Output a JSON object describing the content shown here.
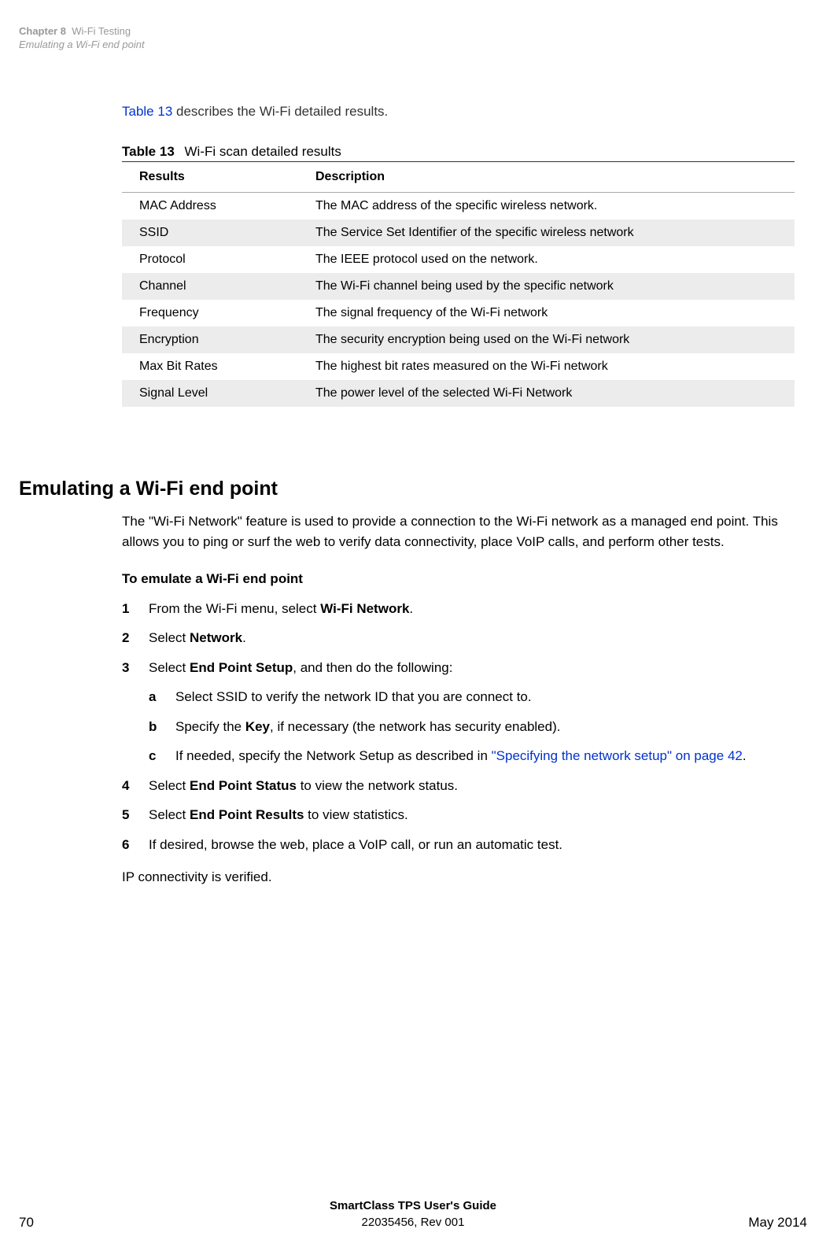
{
  "header": {
    "chapter_label": "Chapter 8",
    "chapter_title": "Wi-Fi Testing",
    "subtitle": "Emulating a Wi-Fi end point"
  },
  "intro": {
    "link_text": "Table 13",
    "rest": " describes the Wi-Fi detailed results."
  },
  "table": {
    "number": "Table 13",
    "title": "Wi-Fi scan detailed results",
    "col1": "Results",
    "col2": "Description",
    "rows": [
      {
        "r": "MAC Address",
        "d": "The MAC address of the specific wireless network."
      },
      {
        "r": "SSID",
        "d": "The Service Set Identifier of the specific wireless network"
      },
      {
        "r": "Protocol",
        "d": "The IEEE protocol used on the network."
      },
      {
        "r": "Channel",
        "d": "The Wi-Fi channel being used by the specific network"
      },
      {
        "r": "Frequency",
        "d": "The signal frequency of the Wi-Fi network"
      },
      {
        "r": "Encryption",
        "d": "The security encryption being used on the Wi-Fi network"
      },
      {
        "r": "Max Bit Rates",
        "d": "The highest bit rates measured on the Wi-Fi network"
      },
      {
        "r": "Signal Level",
        "d": "The power level of the selected Wi-Fi Network"
      }
    ]
  },
  "section": {
    "heading": "Emulating a Wi-Fi end point",
    "para": "The \"Wi-Fi Network\" feature is used to provide a connection to the Wi-Fi network as a managed end point. This allows you to ping or surf the web to verify data connectivity, place VoIP calls, and perform other tests.",
    "subhead": "To emulate a Wi-Fi end point",
    "steps": {
      "s1_pre": "From the Wi-Fi menu, select ",
      "s1_bold": "Wi-Fi Network",
      "s1_post": ".",
      "s2_pre": "Select ",
      "s2_bold": "Network",
      "s2_post": ".",
      "s3_pre": "Select ",
      "s3_bold": "End Point Setup",
      "s3_post": ", and then do the following:",
      "sa": "Select SSID to verify the network ID that you are connect to.",
      "sb_pre": "Specify the ",
      "sb_bold": "Key",
      "sb_post": ", if necessary (the network has security enabled).",
      "sc_pre": "If needed, specify the Network Setup as described in ",
      "sc_link": "\"Specifying the network setup\" on page 42",
      "sc_post": ".",
      "s4_pre": "Select ",
      "s4_bold": "End Point Status",
      "s4_post": " to view the network status.",
      "s5_pre": "Select ",
      "s5_bold": "End Point Results",
      "s5_post": " to view statistics.",
      "s6": "If desired, browse the web, place a VoIP call, or run an automatic test."
    },
    "closing": "IP connectivity is verified."
  },
  "footer": {
    "guide": "SmartClass TPS User's Guide",
    "doc": "22035456, Rev 001",
    "page": "70",
    "date": "May 2014"
  },
  "nums": {
    "n1": "1",
    "n2": "2",
    "n3": "3",
    "n4": "4",
    "n5": "5",
    "n6": "6",
    "a": "a",
    "b": "b",
    "c": "c"
  }
}
